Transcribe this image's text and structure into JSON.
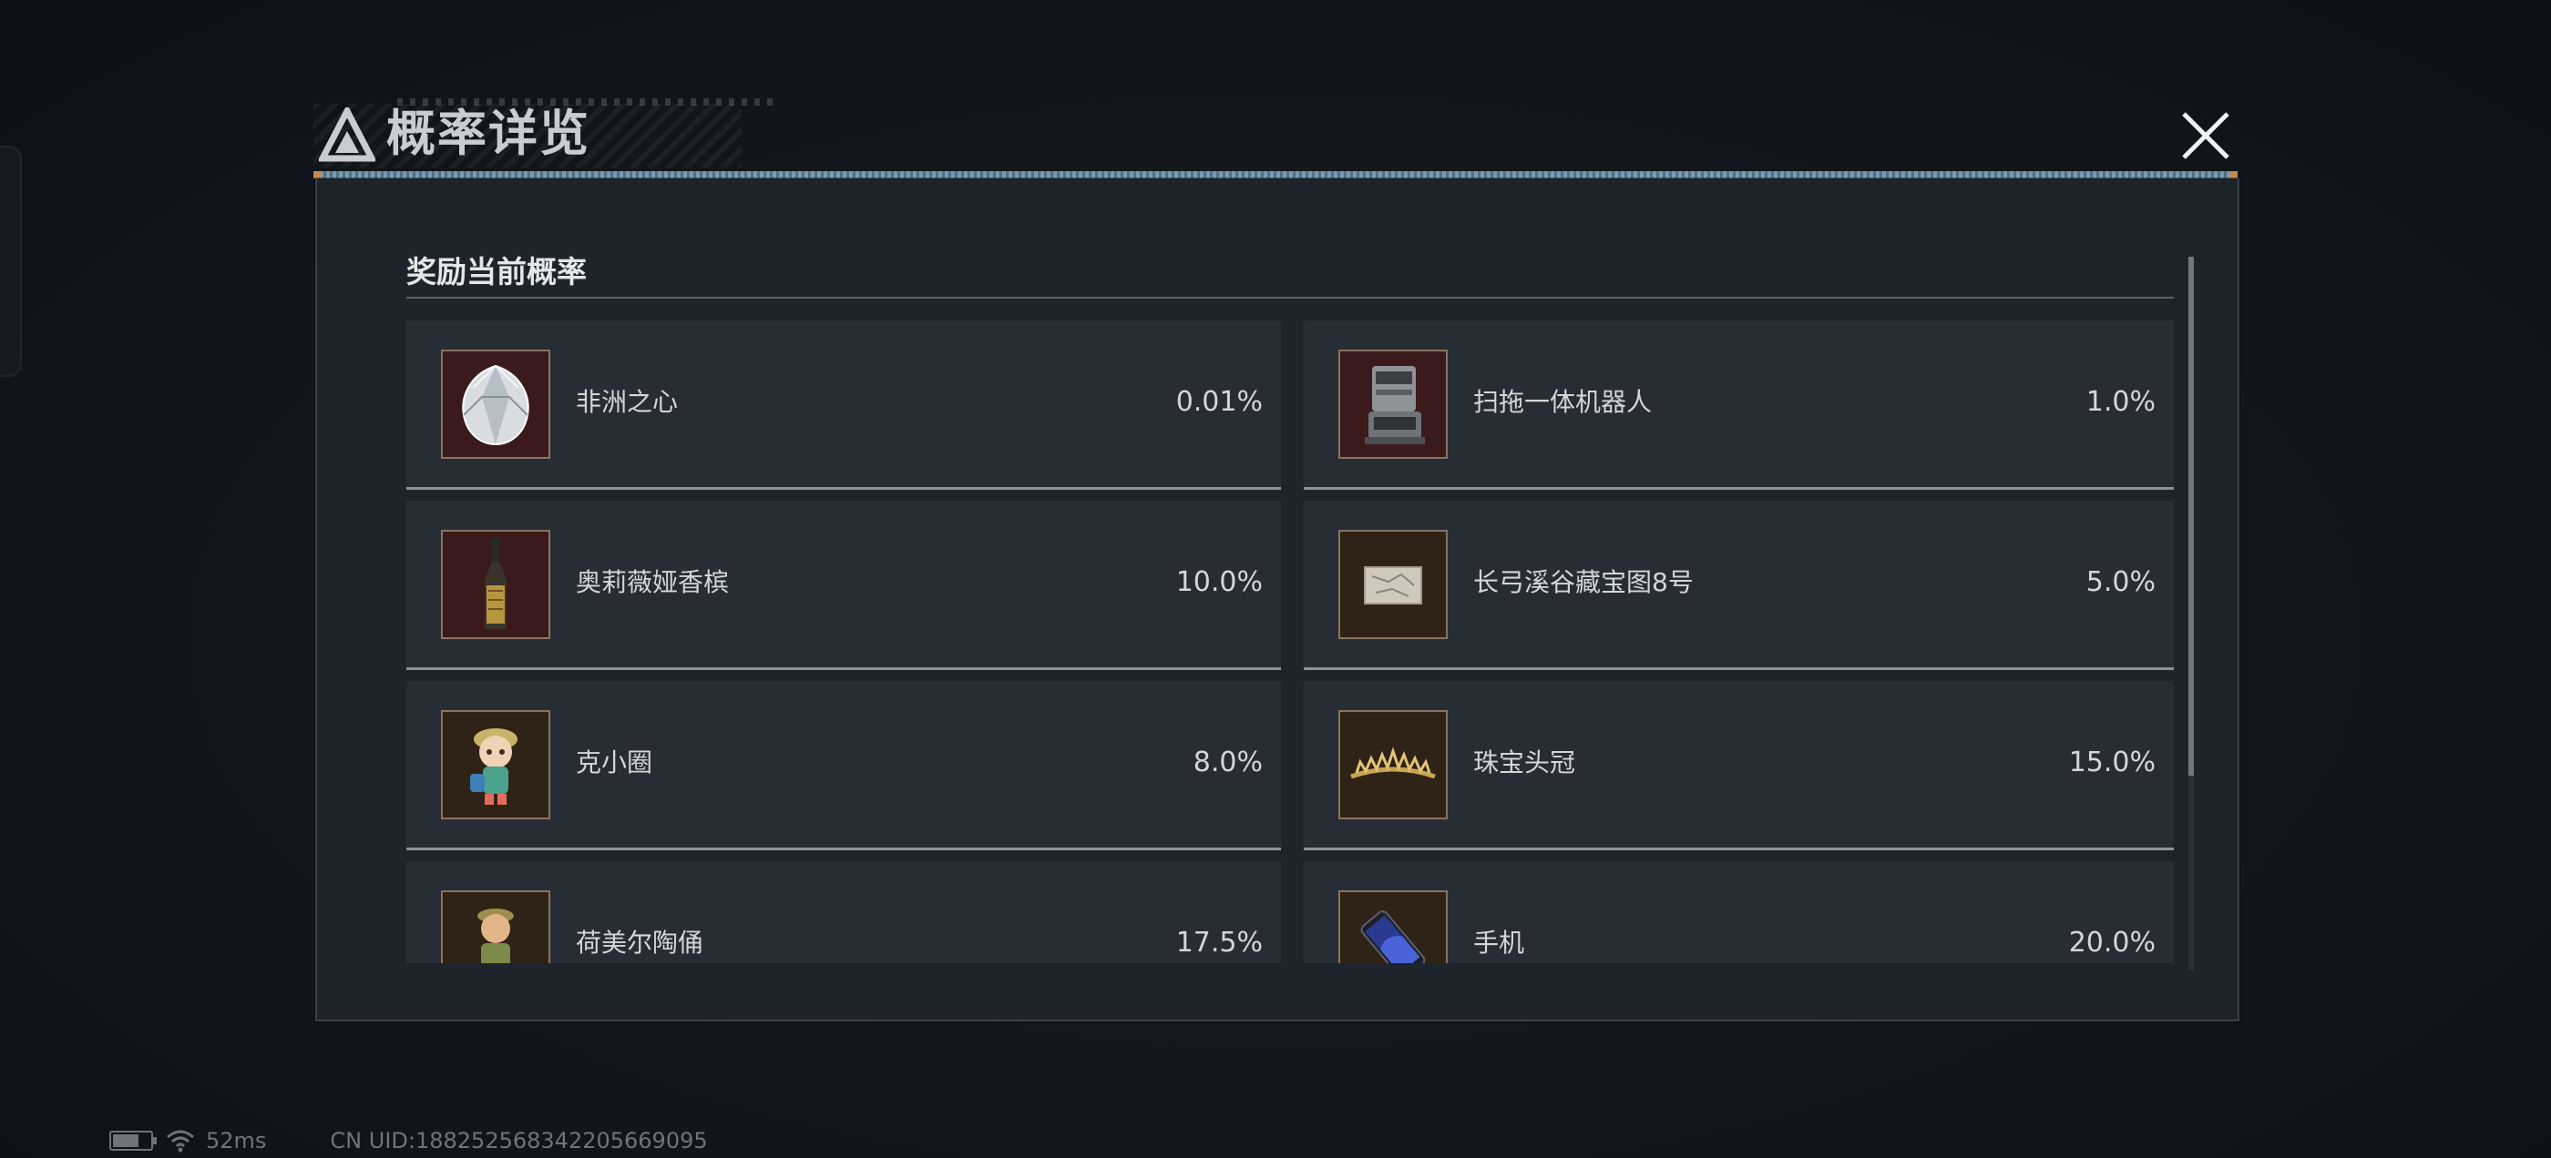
{
  "dialog": {
    "title": "概率详览",
    "close_label": "✕",
    "section_title": "奖励当前概率"
  },
  "items": [
    {
      "name": "非洲之心",
      "prob": "0.01%",
      "icon": "diamond-icon"
    },
    {
      "name": "扫拖一体机器人",
      "prob": "1.0%",
      "icon": "robot-vacuum-icon"
    },
    {
      "name": "奥莉薇娅香槟",
      "prob": "10.0%",
      "icon": "champagne-bottle-icon"
    },
    {
      "name": "长弓溪谷藏宝图8号",
      "prob": "5.0%",
      "icon": "treasure-map-icon"
    },
    {
      "name": "克小圈",
      "prob": "8.0%",
      "icon": "figurine-icon"
    },
    {
      "name": "珠宝头冠",
      "prob": "15.0%",
      "icon": "tiara-icon"
    },
    {
      "name": "荷美尔陶俑",
      "prob": "17.5%",
      "icon": "clay-figurine-icon"
    },
    {
      "name": "手机",
      "prob": "20.0%",
      "icon": "phone-icon"
    }
  ],
  "status_bar": {
    "ping": "52ms",
    "uid": "CN UID:188252568342205669095"
  },
  "colors": {
    "background": "#12171e",
    "panel": "#1e242b",
    "item_bg": "#272d34",
    "thumb_red": "#3b1a1b",
    "thumb_brown": "#2f2216",
    "accent_line": "#8ab1c9"
  }
}
